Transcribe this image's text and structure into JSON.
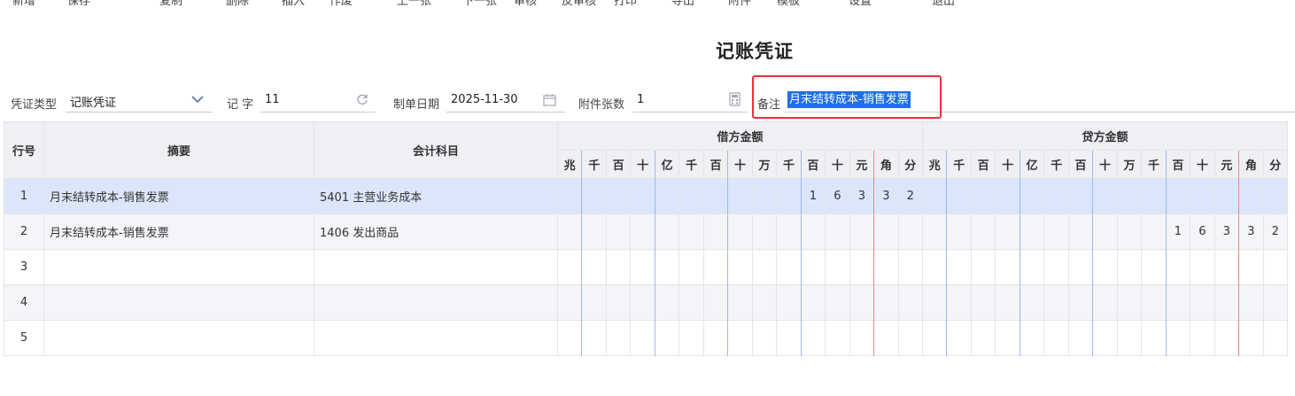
{
  "toolbar": {
    "items": [
      "新增",
      "保存",
      "复制",
      "删除",
      "插入",
      "作废",
      "上一张",
      "下一张",
      "审核",
      "反审核",
      "打印",
      "导出",
      "附件",
      "模板",
      "设置",
      "退出"
    ]
  },
  "page_title": "记账凭证",
  "header_fields": {
    "voucher_type_label": "凭证类型",
    "voucher_type_value": "记账凭证",
    "voucher_word_label": "记 字",
    "voucher_number": "11",
    "date_label": "制单日期",
    "date_value": "2025-11-30",
    "attachments_label": "附件张数",
    "attachments_value": "1",
    "remark_label": "备注",
    "remark_value": "月末结转成本-销售发票"
  },
  "table": {
    "col_row_no": "行号",
    "col_summary": "摘要",
    "col_account": "会计科目",
    "col_debit": "借方金额",
    "col_credit": "贷方金额",
    "digit_units": [
      "兆",
      "千",
      "百",
      "十",
      "亿",
      "千",
      "百",
      "十",
      "万",
      "千",
      "百",
      "十",
      "元",
      "角",
      "分"
    ],
    "rows": [
      {
        "no": "1",
        "summary": "月末结转成本-销售发票",
        "account": "5401 主营业务成本",
        "debit": [
          "",
          "",
          "",
          "",
          "",
          "",
          "",
          "",
          "",
          "",
          "1",
          "6",
          "3",
          "3",
          "2"
        ],
        "credit": [
          "",
          "",
          "",
          "",
          "",
          "",
          "",
          "",
          "",
          "",
          "",
          "",
          "",
          "",
          ""
        ]
      },
      {
        "no": "2",
        "summary": "月末结转成本-销售发票",
        "account": "1406 发出商品",
        "debit": [
          "",
          "",
          "",
          "",
          "",
          "",
          "",
          "",
          "",
          "",
          "",
          "",
          "",
          "",
          ""
        ],
        "credit": [
          "",
          "",
          "",
          "",
          "",
          "",
          "",
          "",
          "",
          "",
          "1",
          "6",
          "3",
          "3",
          "2"
        ]
      },
      {
        "no": "3",
        "summary": "",
        "account": "",
        "debit": [
          "",
          "",
          "",
          "",
          "",
          "",
          "",
          "",
          "",
          "",
          "",
          "",
          "",
          "",
          ""
        ],
        "credit": [
          "",
          "",
          "",
          "",
          "",
          "",
          "",
          "",
          "",
          "",
          "",
          "",
          "",
          "",
          ""
        ]
      },
      {
        "no": "4",
        "summary": "",
        "account": "",
        "debit": [
          "",
          "",
          "",
          "",
          "",
          "",
          "",
          "",
          "",
          "",
          "",
          "",
          "",
          "",
          ""
        ],
        "credit": [
          "",
          "",
          "",
          "",
          "",
          "",
          "",
          "",
          "",
          "",
          "",
          "",
          "",
          "",
          ""
        ]
      },
      {
        "no": "5",
        "summary": "",
        "account": "",
        "debit": [
          "",
          "",
          "",
          "",
          "",
          "",
          "",
          "",
          "",
          "",
          "",
          "",
          "",
          "",
          ""
        ],
        "credit": [
          "",
          "",
          "",
          "",
          "",
          "",
          "",
          "",
          "",
          "",
          "",
          "",
          "",
          "",
          ""
        ]
      }
    ]
  },
  "icons": {
    "dropdown": "chevron-down-icon",
    "refresh": "refresh-icon",
    "calendar": "calendar-icon",
    "calculator": "calculator-icon"
  },
  "colors": {
    "selection": "#1e6fe8",
    "selected_row": "#dce6fb",
    "highlight_border": "#e8333a",
    "yuan_divider": "#e88a8a",
    "group_divider": "#9db9ee"
  }
}
